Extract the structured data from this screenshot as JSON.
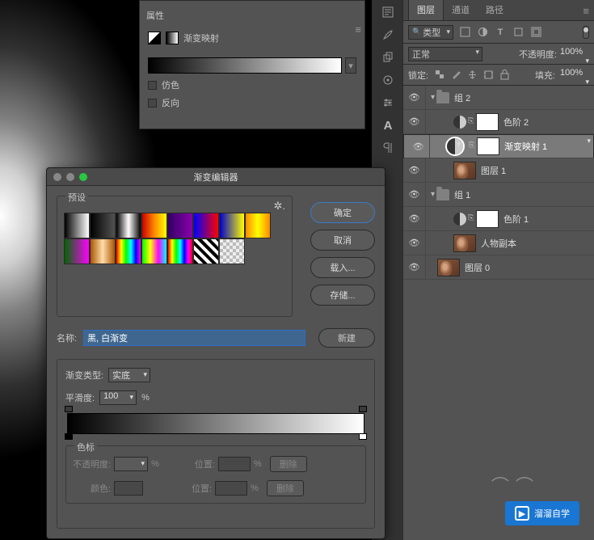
{
  "properties": {
    "title": "属性",
    "adj_name": "渐变映射",
    "dither": "仿色",
    "reverse": "反向"
  },
  "gradient_editor": {
    "title": "渐变编辑器",
    "presets_label": "预设",
    "ok": "确定",
    "cancel": "取消",
    "load": "载入...",
    "save": "存储...",
    "name_label": "名称:",
    "name_value": "黑, 白渐变",
    "new_btn": "新建",
    "type_label": "渐变类型:",
    "type_value": "实底",
    "smooth_label": "平滑度:",
    "smooth_value": "100",
    "pct": "%",
    "stops_label": "色标",
    "opacity_label": "不透明度:",
    "location_label": "位置:",
    "color_label": "颜色:",
    "delete": "删除"
  },
  "presets": [
    {
      "css": "linear-gradient(90deg,#000,#fff)"
    },
    {
      "css": "linear-gradient(90deg,#000,transparent)"
    },
    {
      "css": "linear-gradient(90deg,#000,#fff,#000)"
    },
    {
      "css": "linear-gradient(90deg,#c00,#f80,#ff0)"
    },
    {
      "css": "linear-gradient(90deg,#306,#80a)"
    },
    {
      "css": "linear-gradient(90deg,#00f,#f00)"
    },
    {
      "css": "linear-gradient(90deg,#00c,#ff0)"
    },
    {
      "css": "linear-gradient(90deg,#f80,#ff0,#f80)"
    },
    {
      "css": "linear-gradient(90deg,#060,#f0f)"
    },
    {
      "css": "linear-gradient(90deg,#a50,#fda,#a50)"
    },
    {
      "css": "linear-gradient(90deg,#f00,#ff0,#0f0,#0ff,#00f,#f0f)"
    },
    {
      "css": "linear-gradient(90deg,#0f0,#ff0,#f0f,#0ff)"
    },
    {
      "css": "linear-gradient(90deg,#f00,#ff0,#0f0,#0ff,#00f,#f0f,#f00)"
    },
    {
      "css": "repeating-linear-gradient(45deg,#000 0 4px,#fff 4px 8px)"
    },
    {
      "css": "repeating-conic-gradient(#bbb 0 25%,#eee 0 50%)"
    }
  ],
  "layers_panel": {
    "tabs": {
      "layers": "图层",
      "channels": "通道",
      "paths": "路径"
    },
    "kind": "类型",
    "blend_mode": "正常",
    "opacity_label": "不透明度:",
    "opacity": "100%",
    "lock_label": "锁定:",
    "fill_label": "填充:",
    "fill": "100%",
    "items": {
      "group2": "组 2",
      "levels2": "色阶 2",
      "gradmap1": "渐变映射 1",
      "layer1": "图层 1",
      "group1": "组 1",
      "levels1": "色阶 1",
      "person_copy": "人物副本",
      "layer0": "图层 0"
    }
  },
  "watermark": {
    "text": "溜溜自学"
  }
}
